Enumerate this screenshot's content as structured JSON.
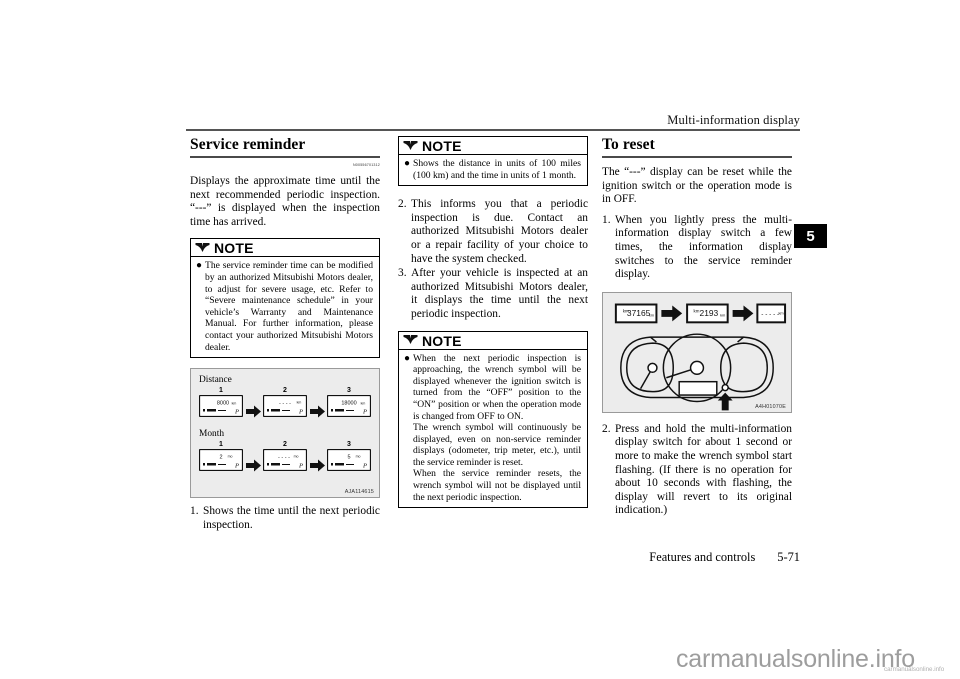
{
  "header": {
    "running_title": "Multi-information display",
    "chapter_tab": "5"
  },
  "footer": {
    "section_label": "Features and controls",
    "page_number": "5-71"
  },
  "watermark": {
    "big": "carmanualsonline.info",
    "small": "carmanualsonline.info"
  },
  "left_column": {
    "heading": "Service reminder",
    "ref_code": "N00556701312",
    "intro": "Displays the approximate time until the next recommended periodic inspection. “---” is displayed when the inspection time has arrived.",
    "note": {
      "label": "NOTE",
      "icon": "butterfly-mark-icon",
      "bullets": [
        "The service reminder time can be modified by an authorized Mitsubishi Motors dealer, to adjust for severe usage, etc. Refer to “Severe maintenance schedule” in your vehicle’s Warranty and Maintenance Manual. For further information, please contact your authorized Mitsubishi Motors dealer."
      ]
    },
    "figure": {
      "ref_code": "AJA114615",
      "row_labels": [
        "Distance",
        "Month"
      ],
      "step_numbers": [
        "1",
        "2",
        "3"
      ],
      "distance_displays": [
        "8000 km",
        "- - - -",
        "18000 km"
      ],
      "month_displays": [
        "2",
        "- - - -",
        "5"
      ],
      "arrow_icon": "right-arrow-icon"
    },
    "list": [
      {
        "number": "1.",
        "text": "Shows the time until the next periodic inspection."
      }
    ]
  },
  "middle_column": {
    "note_top": {
      "label": "NOTE",
      "icon": "butterfly-mark-icon",
      "bullets": [
        "Shows the distance in units of 100 miles (100 km) and the time in units of 1 month."
      ]
    },
    "list": [
      {
        "number": "2.",
        "text": "This informs you that a periodic inspection is due. Contact an authorized Mitsubishi Motors dealer or a repair facility of your choice to have the system checked."
      },
      {
        "number": "3.",
        "text": "After your vehicle is inspected at an authorized Mitsubishi Motors dealer, it displays the time until the next periodic inspection."
      }
    ],
    "note_bottom": {
      "label": "NOTE",
      "icon": "butterfly-mark-icon",
      "bullets": [
        "When the next periodic inspection is approaching, the wrench symbol will be displayed whenever the ignition switch is turned from the “OFF” position to the “ON” position or when the operation mode is changed from OFF to ON.",
        "The wrench symbol will continuously be displayed, even on non-service reminder displays (odometer, trip meter, etc.), until the service reminder is reset.",
        "When the service reminder resets, the wrench symbol will not be displayed until the next periodic inspection."
      ]
    }
  },
  "right_column": {
    "heading": "To reset",
    "intro": "The “---” display can be reset while the ignition switch or the operation mode is in OFF.",
    "list": [
      {
        "number": "1.",
        "text": "When you lightly press the multi-information display switch a few times, the information display switches to the service reminder display."
      },
      {
        "number": "2.",
        "text": "Press and hold the multi-information display switch for about 1 second or more to make the wrench symbol start flashing. (If there is no operation for about 10 seconds with flashing, the display will revert to its original indication.)"
      }
    ],
    "figure": {
      "ref_code": "A4H01070E",
      "displays": [
        "37165 km",
        "2193 km",
        "- - - - - -"
      ],
      "arrow_icon": "right-arrow-icon",
      "cluster_icon": "instrument-cluster-icon",
      "pointer_icon": "up-arrow-pointer-icon"
    }
  },
  "colors": {
    "figure_bg": "#ececec",
    "figure_border": "#9a9a9a",
    "rule": "#4a4a4a",
    "watermark": "#9d9d9d"
  }
}
